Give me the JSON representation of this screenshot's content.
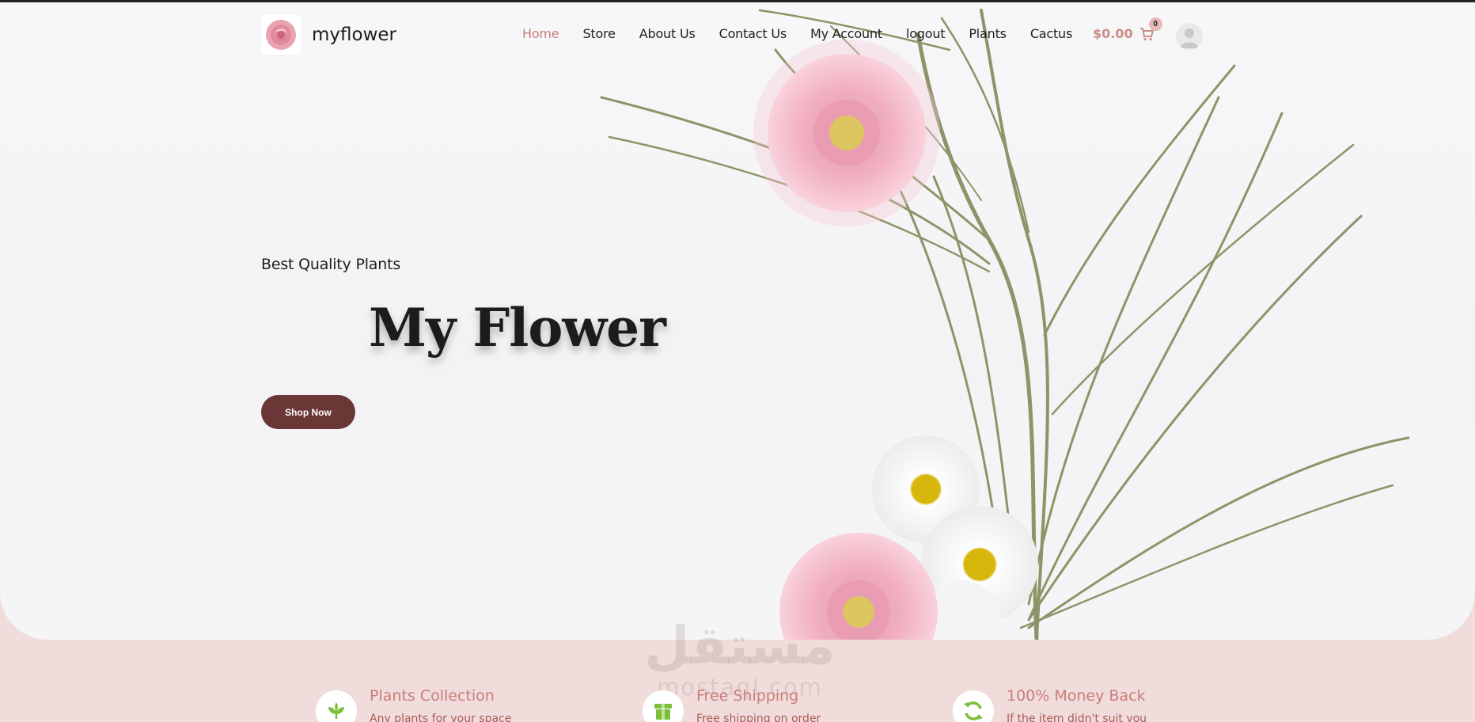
{
  "brand": {
    "name": "myflower",
    "logo_icon": "rose-logo-icon"
  },
  "nav": {
    "items": [
      "Home",
      "Store",
      "About Us",
      "Contact Us",
      "My Account",
      "logout",
      "Plants",
      "Cactus"
    ],
    "active": "Home"
  },
  "cart": {
    "total": "$0.00",
    "count": "0",
    "icon": "cart-icon"
  },
  "account": {
    "icon": "user-avatar-icon"
  },
  "hero": {
    "tagline": "Best Quality Plants",
    "title": "My Flower",
    "cta_label": "Shop Now"
  },
  "watermark": {
    "arabic": "مستقل",
    "latin": "mostaql.com"
  },
  "features": [
    {
      "title": "Plants Collection",
      "desc": "Any plants for your space",
      "icon": "sprout-icon"
    },
    {
      "title": "Free Shipping",
      "desc": "Free shipping on order",
      "icon": "box-icon"
    },
    {
      "title": "100% Money Back",
      "desc": "If the item didn't suit you",
      "icon": "refresh-icon"
    }
  ],
  "colors": {
    "accent": "#c97e7a",
    "button": "#6b3636",
    "section_bg": "#f1dcdc",
    "icon_green": "#7cbf3a"
  }
}
